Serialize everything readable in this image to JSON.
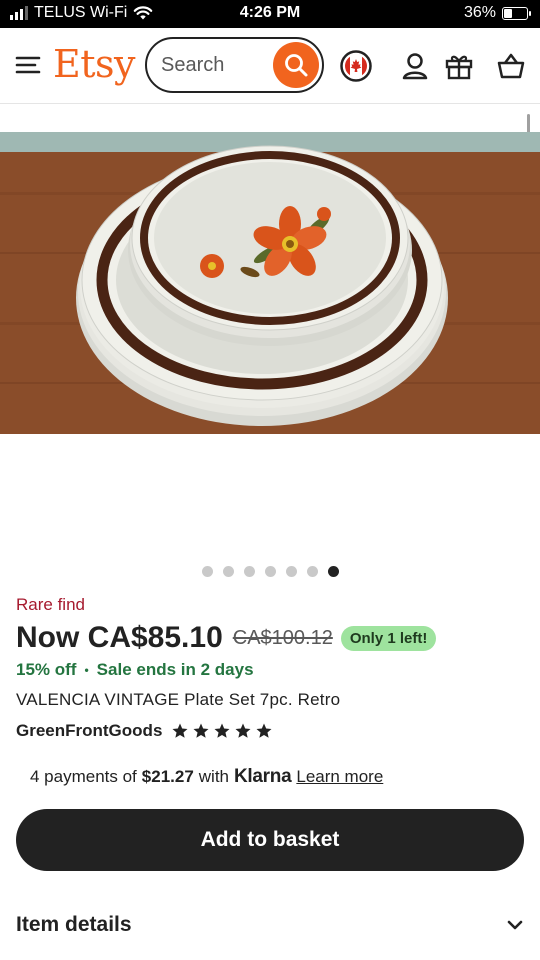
{
  "status_bar": {
    "carrier": "TELUS Wi-Fi",
    "time": "4:26 PM",
    "battery_percent": "36%",
    "battery_level": 0.36
  },
  "header": {
    "logo": "Etsy",
    "search_placeholder": "Search",
    "brand_color": "#f1641e"
  },
  "gallery": {
    "image_count": 7,
    "active_index": 6,
    "image_description": "stack of plates"
  },
  "product": {
    "badge": "Rare find",
    "price_now": "Now CA$85.10",
    "price_original": "CA$100.12",
    "stock_badge": "Only 1 left!",
    "discount": "15% off",
    "sale_separator": "•",
    "sale_ends": "Sale ends in 2 days",
    "title": "VALENCIA VINTAGE Plate Set 7pc. Retro",
    "shop_name": "GreenFrontGoods",
    "rating_stars": 5
  },
  "klarna": {
    "prefix": "4 payments of",
    "amount": "$21.27",
    "with": "with",
    "brand": "Klarna",
    "link": "Learn more"
  },
  "actions": {
    "add_to_basket": "Add to basket"
  },
  "details": {
    "label": "Item details"
  }
}
